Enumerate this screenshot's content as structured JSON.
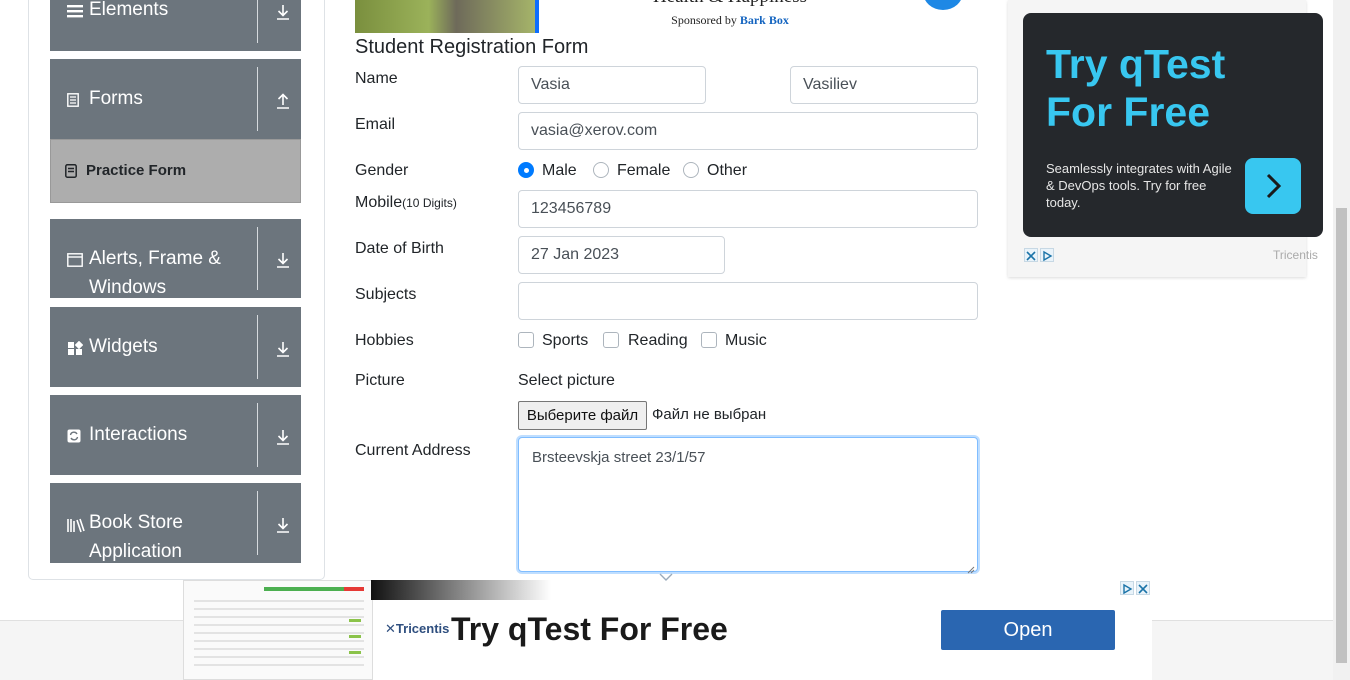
{
  "sidebar": {
    "groups": [
      {
        "label": "Elements",
        "icon": "hamburger-icon",
        "arrow": "download-arrow-icon"
      },
      {
        "label": "Forms",
        "icon": "document-icon",
        "arrow": "upload-arrow-icon"
      },
      {
        "label": "Alerts, Frame & Windows",
        "icon": "window-icon",
        "arrow": "download-arrow-icon"
      },
      {
        "label": "Widgets",
        "icon": "widgets-icon",
        "arrow": "download-arrow-icon"
      },
      {
        "label": "Interactions",
        "icon": "interactions-icon",
        "arrow": "download-arrow-icon"
      },
      {
        "label": "Book Store Application",
        "icon": "books-icon",
        "arrow": "download-arrow-icon"
      }
    ],
    "active_item": {
      "label": "Practice Form",
      "icon": "form-icon"
    }
  },
  "top_ad": {
    "title": "Health & Happiness",
    "sponsored_prefix": "Sponsored by ",
    "sponsor": "Bark Box"
  },
  "form": {
    "title": "Student Registration Form",
    "name": {
      "label": "Name",
      "first_value": "Vasia",
      "last_value": "Vasiliev"
    },
    "email": {
      "label": "Email",
      "value": "vasia@xerov.com"
    },
    "gender": {
      "label": "Gender",
      "options": [
        "Male",
        "Female",
        "Other"
      ],
      "selected": "Male"
    },
    "mobile": {
      "label": "Mobile",
      "label_hint": "(10 Digits)",
      "value": "123456789"
    },
    "dob": {
      "label": "Date of Birth",
      "value": "27 Jan 2023"
    },
    "subjects": {
      "label": "Subjects",
      "value": ""
    },
    "hobbies": {
      "label": "Hobbies",
      "options": [
        "Sports",
        "Reading",
        "Music"
      ],
      "checked": []
    },
    "picture": {
      "label": "Picture",
      "caption": "Select picture",
      "button": "Выберите файл",
      "status": "Файл не выбран"
    },
    "address": {
      "label": "Current Address",
      "value": "Brsteevskja street 23/1/57"
    }
  },
  "side_ad": {
    "headline_1": "Try qTest",
    "headline_2": "For Free",
    "body": "Seamlessly integrates with Agile & DevOps tools. Try for free today.",
    "brand": "Tricentis",
    "accent": "#38c7f0",
    "card_bg": "#25282c"
  },
  "bottom_ad": {
    "brand": "Tricentis",
    "title": "Try qTest For Free",
    "button": "Open",
    "button_color": "#2a66b1"
  }
}
